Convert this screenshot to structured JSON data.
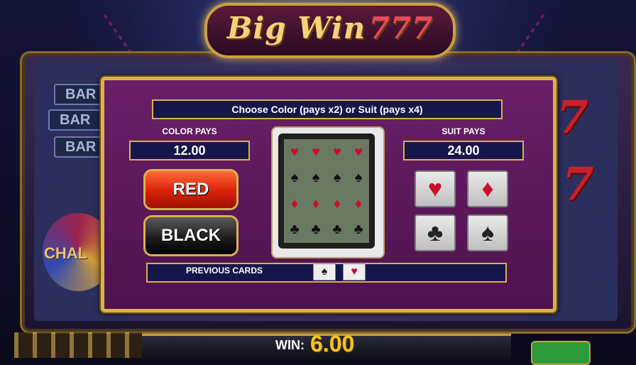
{
  "logo": {
    "text": "Big Win",
    "sevens": "777"
  },
  "background": {
    "reel_bar_symbols": [
      "BAR",
      "BAR",
      "BAR"
    ],
    "wheel_text": "CHAL"
  },
  "gamble": {
    "instruction": "Choose Color (pays x2) or Suit (pays x4)",
    "color_pays_label": "COLOR PAYS",
    "color_pays_value": "12.00",
    "suit_pays_label": "SUIT PAYS",
    "suit_pays_value": "24.00",
    "red_button": "RED",
    "black_button": "BLACK",
    "previous_cards_label": "PREVIOUS CARDS",
    "suits": [
      {
        "name": "hearts",
        "symbol": "♥",
        "color": "#c8102a"
      },
      {
        "name": "diamonds",
        "symbol": "♦",
        "color": "#c8102a"
      },
      {
        "name": "clubs",
        "symbol": "♣",
        "color": "#222222"
      },
      {
        "name": "spades",
        "symbol": "♠",
        "color": "#222222"
      }
    ],
    "previous_cards": [
      {
        "suit": "spades",
        "symbol": "♠"
      },
      {
        "suit": "hearts",
        "symbol": "♥"
      }
    ]
  },
  "footer": {
    "win_label": "WIN:",
    "win_value": "6.00"
  },
  "colors": {
    "accent_gold": "#d9b24a",
    "dialog_purple": "#6a1f68",
    "win_yellow": "#f5c518"
  }
}
